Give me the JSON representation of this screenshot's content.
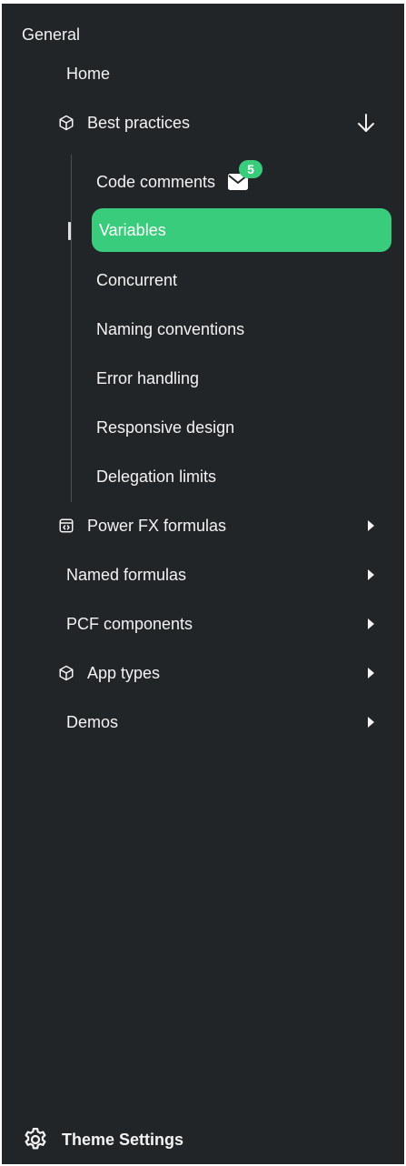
{
  "section": {
    "title": "General"
  },
  "nav": {
    "home": {
      "label": "Home"
    },
    "best_practices": {
      "label": "Best practices",
      "icon": "box-icon",
      "expand_icon": "arrow-down-icon",
      "children": [
        {
          "label": "Code comments",
          "badge": "5",
          "icon": "mail-icon"
        },
        {
          "label": "Variables",
          "active": true
        },
        {
          "label": "Concurrent"
        },
        {
          "label": "Naming conventions"
        },
        {
          "label": "Error handling"
        },
        {
          "label": "Responsive design"
        },
        {
          "label": "Delegation limits"
        }
      ]
    },
    "power_fx": {
      "label": "Power FX formulas",
      "icon": "code-window-icon"
    },
    "named_formulas": {
      "label": "Named formulas"
    },
    "pcf_components": {
      "label": "PCF components"
    },
    "app_types": {
      "label": "App types",
      "icon": "box-icon"
    },
    "demos": {
      "label": "Demos"
    }
  },
  "footer": {
    "label": "Theme Settings",
    "icon": "gear-icon"
  },
  "colors": {
    "background": "#212528",
    "accent": "#3acc7d",
    "text": "#f3f3f3"
  }
}
